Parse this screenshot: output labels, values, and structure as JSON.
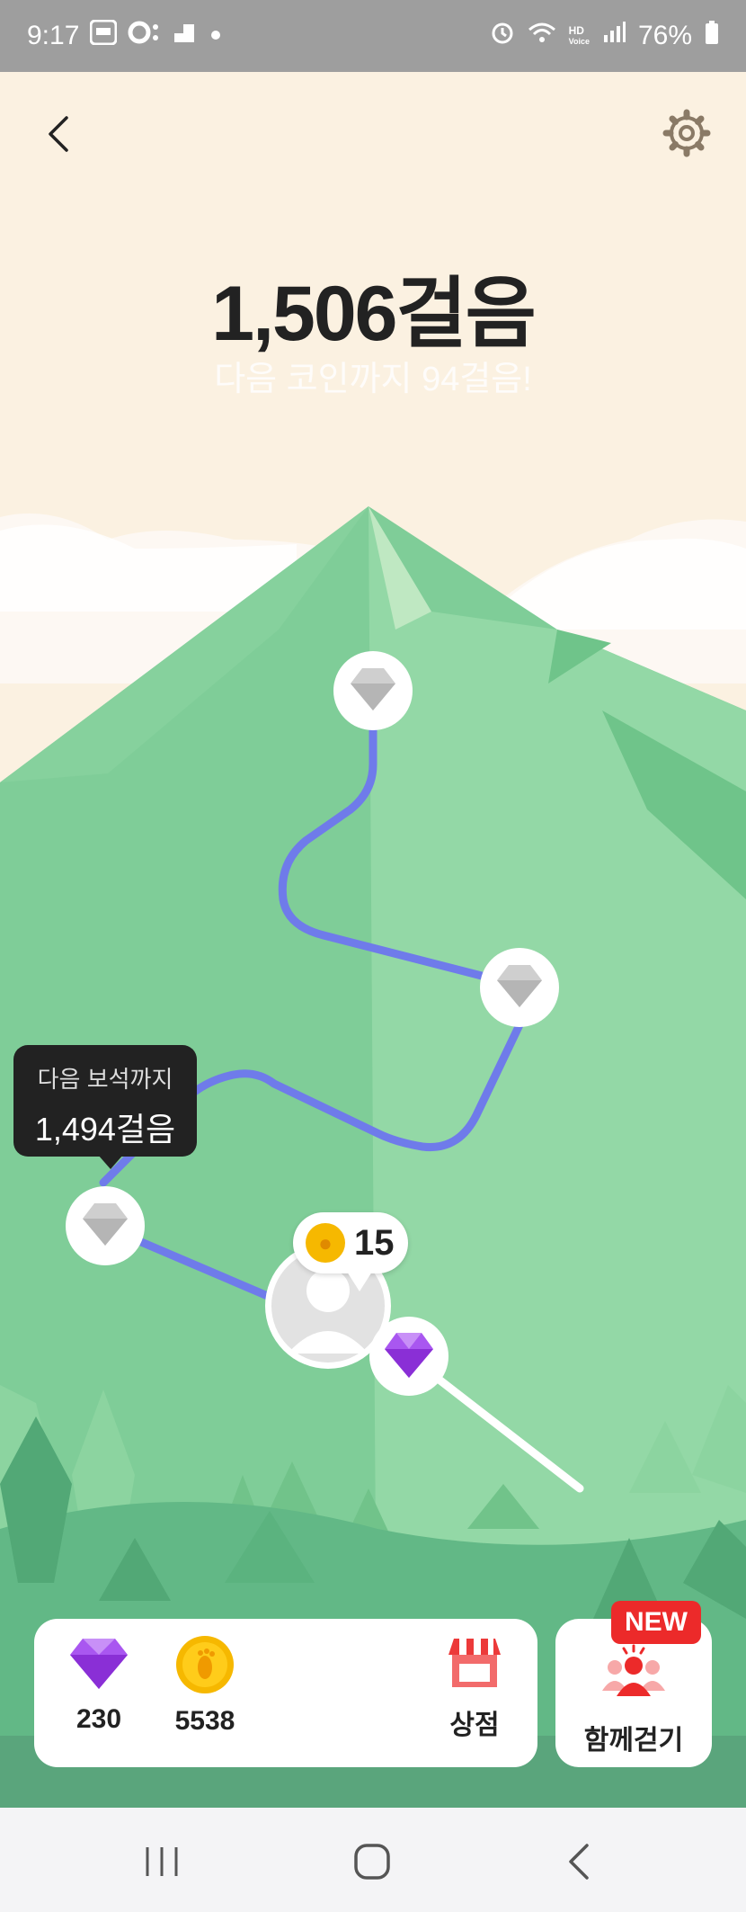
{
  "status_bar": {
    "time": "9:17",
    "battery": "76%",
    "hd_label": "HD",
    "voice_label": "Voice",
    "icons": [
      "app-icon",
      "dnd-icon",
      "notification-icon",
      "dot-icon",
      "alarm-icon",
      "wifi-icon",
      "signal-icon",
      "battery-icon"
    ]
  },
  "header": {
    "steps": "1,506걸음",
    "subtitle": "다음 코인까지 94걸음!"
  },
  "tooltip": {
    "line1": "다음 보석까지",
    "line2": "1,494걸음"
  },
  "coin_bubble": {
    "value": "15"
  },
  "bottom": {
    "gems": "230",
    "coins": "5538",
    "shop_label": "상점",
    "walk_together_label": "함께걷기",
    "new_badge": "NEW"
  },
  "colors": {
    "sky": "#fbf1e1",
    "mountain": "#7fcd98",
    "path": "#6f7bea",
    "accent_red": "#ec2a2a",
    "gem_purple": "#9b3ae0",
    "coin_gold": "#f6b800"
  }
}
